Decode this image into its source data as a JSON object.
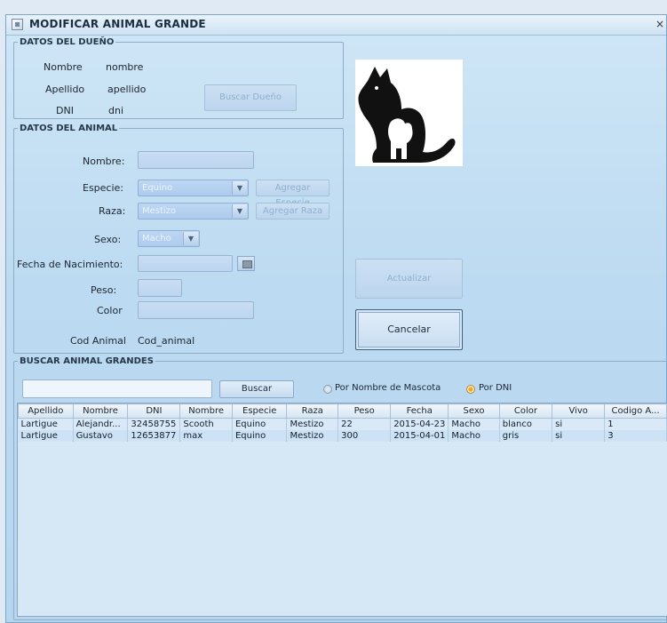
{
  "window": {
    "title": "MODIFICAR ANIMAL GRANDE",
    "close": "×"
  },
  "owner": {
    "legend": "DATOS DEL DUEÑO",
    "name_label": "Nombre",
    "name_value": "nombre",
    "surname_label": "Apellido",
    "surname_value": "apellido",
    "dni_label": "DNI",
    "dni_value": "dni",
    "search_button": "Buscar Dueño"
  },
  "animal": {
    "legend": "DATOS DEL ANIMAL",
    "name_label": "Nombre:",
    "species_label": "Especie:",
    "species_value": "Equino",
    "add_species_button": "Agregar Especie",
    "breed_label": "Raza:",
    "breed_value": "Mestizo",
    "add_breed_button": "Agregar Raza",
    "sex_label": "Sexo:",
    "sex_value": "Macho",
    "birthdate_label": "Fecha de Nacimiento:",
    "weight_label": "Peso:",
    "color_label": "Color",
    "code_label": "Cod Animal",
    "code_value": "Cod_animal"
  },
  "actions": {
    "update_button": "Actualizar",
    "cancel_button": "Cancelar"
  },
  "search": {
    "legend": "BUSCAR ANIMAL GRANDES",
    "input_value": "",
    "search_button": "Buscar",
    "radio_pet_name": "Por Nombre de Mascota",
    "radio_dni": "Por DNI",
    "selected": "Por DNI"
  },
  "table": {
    "columns": [
      "Apellido",
      "Nombre",
      "DNI",
      "Nombre",
      "Especie",
      "Raza",
      "Peso",
      "Fecha",
      "Sexo",
      "Color",
      "Vivo",
      "Codigo A..."
    ],
    "rows": [
      [
        "Lartigue",
        "Alejandr...",
        "32458755",
        "Scooth",
        "Equino",
        "Mestizo",
        "22",
        "2015-04-23",
        "Macho",
        "blanco",
        "si",
        "1"
      ],
      [
        "Lartigue",
        "Gustavo",
        "12653877",
        "max",
        "Equino",
        "Mestizo",
        "300",
        "2015-04-01",
        "Macho",
        "gris",
        "si",
        "3"
      ]
    ]
  },
  "icons": {
    "app": "app-window-icon",
    "pet_logo": "dog-cat-silhouette-logo",
    "calendar": "calendar-icon",
    "dropdown": "chevron-down-icon"
  }
}
